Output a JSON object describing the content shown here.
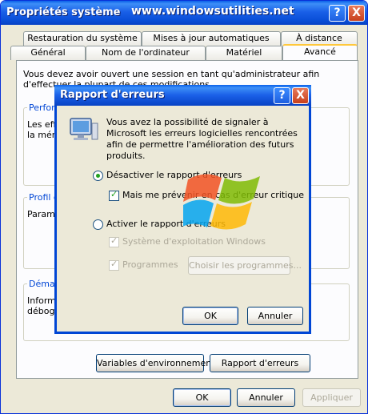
{
  "window": {
    "title": "Propriétés système",
    "watermark": "www.windowsutilities.net",
    "help_label": "?",
    "close_label": "X"
  },
  "tabs": {
    "row1": [
      "Restauration du système",
      "Mises à jour automatiques",
      "À distance"
    ],
    "row2": [
      "Général",
      "Nom de l'ordinateur",
      "Matériel",
      "Avancé"
    ],
    "active": "Avancé"
  },
  "panel": {
    "intro": "Vous devez avoir ouvert une session en tant qu'administrateur afin d'effectuer la plupart de ces modifications.",
    "group_performance_title": "Perform",
    "group_performance_line1": "Les effe",
    "group_performance_line2": "la mém",
    "group_profile_title": "Profil de",
    "group_profile_line1": "Paramè",
    "group_startup_title": "Démarr",
    "group_startup_line1": "Informa",
    "group_startup_line2": "débogag",
    "env_button": "Variables d'environnement",
    "error_report_button": "Rapport d'erreurs"
  },
  "footer": {
    "ok": "OK",
    "cancel": "Annuler",
    "apply": "Appliquer"
  },
  "dialog": {
    "title": "Rapport d'erreurs",
    "help_label": "?",
    "close_label": "X",
    "description": "Vous avez la possibilité de signaler à Microsoft les erreurs logicielles rencontrées afin de permettre l'amélioration des futurs produits.",
    "option_disable": "Désactiver le rapport d'erreurs",
    "option_notify": "Mais me prévenir en cas d'erreur critique",
    "option_enable": "Activer le rapport d'erreurs",
    "option_os": "Système d'exploitation Windows",
    "option_programs": "Programmes",
    "choose_programs": "Choisir les programmes...",
    "ok": "OK",
    "cancel": "Annuler",
    "selected_radio": "disable",
    "notify_checked": true,
    "os_checked": true,
    "programs_checked": true
  },
  "colors": {
    "titlebar": "#0a4fd8",
    "window_bg": "#ece9d8",
    "group_title": "#0046d5",
    "radio_dot": "#21a121"
  }
}
